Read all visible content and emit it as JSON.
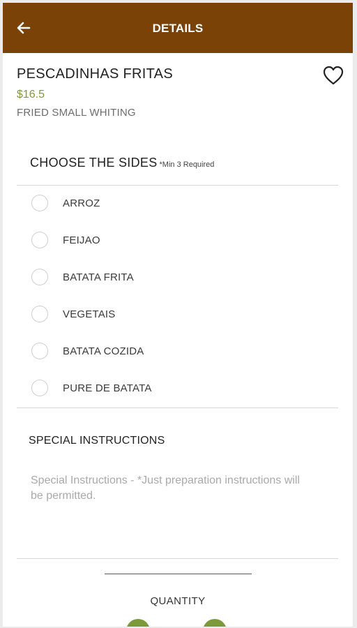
{
  "header": {
    "title": "DETAILS",
    "back_icon": "arrow-left-icon",
    "color": "#7a4206"
  },
  "item": {
    "name": "PESCADINHAS FRITAS",
    "price": "$16.5",
    "description": "FRIED SMALL WHITING",
    "favorite_icon": "heart-outline-icon",
    "price_color": "#7c9a3a"
  },
  "sides": {
    "title": "CHOOSE THE SIDES",
    "requirement": "*Min 3 Required",
    "options": [
      "ARROZ",
      "FEIJAO",
      "BATATA FRITA",
      "VEGETAIS",
      "BATATA COZIDA",
      "PURE DE BATATA"
    ]
  },
  "special_instructions": {
    "title": "SPECIAL INSTRUCTIONS",
    "placeholder": "Special Instructions - *Just preparation instructions will be permitted."
  },
  "quantity": {
    "label": "QUANTITY",
    "button_color": "#7c9a3a"
  }
}
